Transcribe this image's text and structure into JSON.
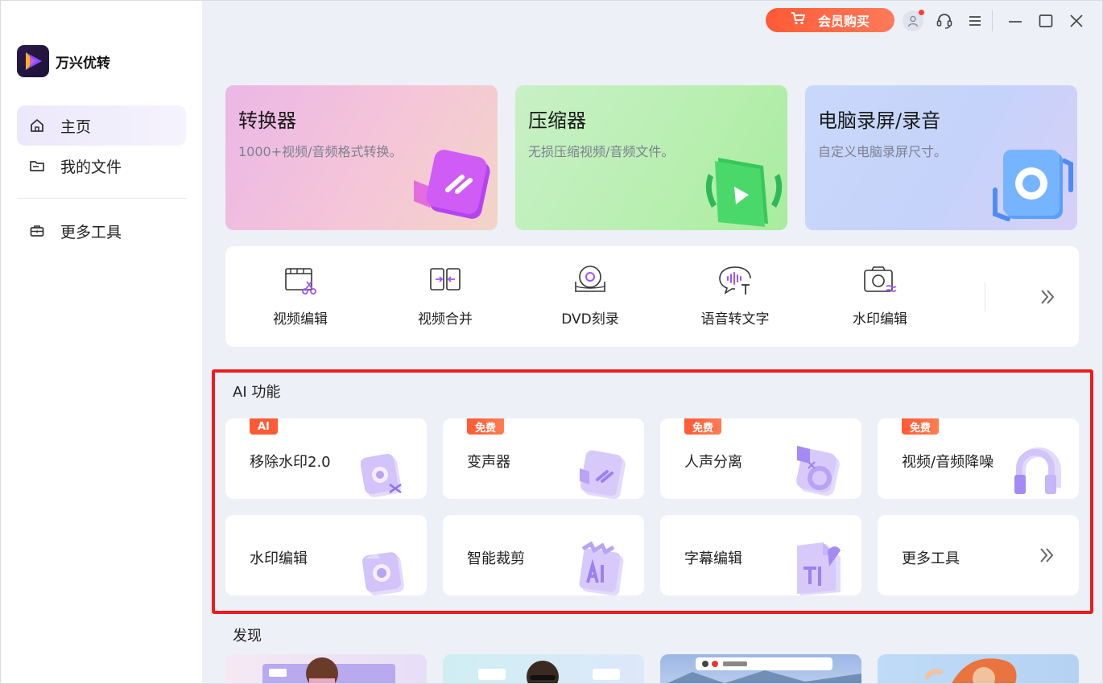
{
  "app": {
    "name": "万兴优转"
  },
  "topbar": {
    "vip_label": "会员购买"
  },
  "sidebar": {
    "items": [
      {
        "label": "主页",
        "icon": "home-icon",
        "active": true
      },
      {
        "label": "我的文件",
        "icon": "folder-icon",
        "active": false
      },
      {
        "label": "更多工具",
        "icon": "toolbox-icon",
        "active": false
      }
    ]
  },
  "features": [
    {
      "title": "转换器",
      "desc": "1000+视频/音频格式转换。",
      "icon": "convert-icon"
    },
    {
      "title": "压缩器",
      "desc": "无损压缩视频/音频文件。",
      "icon": "compress-icon"
    },
    {
      "title": "电脑录屏/录音",
      "desc": "自定义电脑录屏尺寸。",
      "icon": "record-icon"
    }
  ],
  "tools": [
    {
      "label": "视频编辑",
      "icon": "video-edit-icon"
    },
    {
      "label": "视频合并",
      "icon": "video-merge-icon"
    },
    {
      "label": "DVD刻录",
      "icon": "dvd-burn-icon"
    },
    {
      "label": "语音转文字",
      "icon": "speech-to-text-icon"
    },
    {
      "label": "水印编辑",
      "icon": "watermark-edit-icon"
    }
  ],
  "ai_section": {
    "title": "AI 功能",
    "cards": [
      {
        "label": "移除水印2.0",
        "badge": "AI"
      },
      {
        "label": "变声器",
        "badge": "免费"
      },
      {
        "label": "人声分离",
        "badge": "免费"
      },
      {
        "label": "视频/音频降噪",
        "badge": "免费"
      },
      {
        "label": "水印编辑",
        "badge": ""
      },
      {
        "label": "智能裁剪",
        "badge": ""
      },
      {
        "label": "字幕编辑",
        "badge": ""
      },
      {
        "label": "更多工具",
        "badge": ""
      }
    ]
  },
  "discover": {
    "title": "发现"
  },
  "colors": {
    "accent": "#ff5a36",
    "highlight": "#ee1c1c",
    "sidebar_active": "#ece8fb"
  }
}
